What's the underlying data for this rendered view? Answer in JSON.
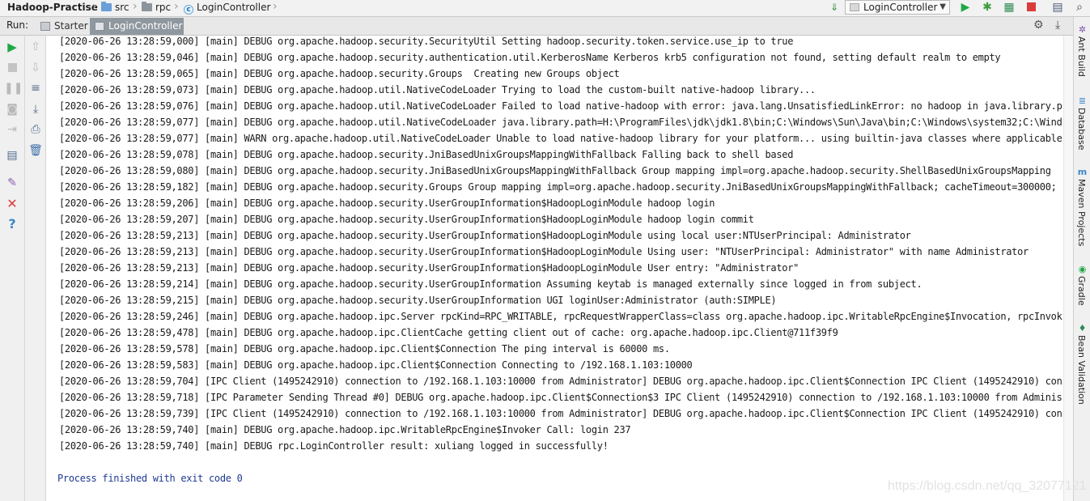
{
  "breadcrumb": {
    "project": "Hadoop-Practise",
    "folder1": "src",
    "folder2": "rpc",
    "file": "LoginController",
    "class_letter": "c"
  },
  "toolbar": {
    "run_config": "LoginController",
    "icons": [
      "build-icon",
      "run-icon",
      "debug-icon",
      "coverage-icon",
      "stop-icon",
      "project-structure-icon",
      "search-icon"
    ]
  },
  "run_panel": {
    "label": "Run:",
    "tabs": [
      {
        "label": "Starter",
        "active": false
      },
      {
        "label": "LoginController",
        "active": true
      }
    ]
  },
  "console": {
    "lines": [
      "[2020-06-26 13:28:59,000] [main] DEBUG org.apache.hadoop.security.SecurityUtil Setting hadoop.security.token.service.use_ip to true",
      "[2020-06-26 13:28:59,046] [main] DEBUG org.apache.hadoop.security.authentication.util.KerberosName Kerberos krb5 configuration not found, setting default realm to empty",
      "[2020-06-26 13:28:59,065] [main] DEBUG org.apache.hadoop.security.Groups  Creating new Groups object",
      "[2020-06-26 13:28:59,073] [main] DEBUG org.apache.hadoop.util.NativeCodeLoader Trying to load the custom-built native-hadoop library...",
      "[2020-06-26 13:28:59,076] [main] DEBUG org.apache.hadoop.util.NativeCodeLoader Failed to load native-hadoop with error: java.lang.UnsatisfiedLinkError: no hadoop in java.library.p",
      "[2020-06-26 13:28:59,077] [main] DEBUG org.apache.hadoop.util.NativeCodeLoader java.library.path=H:\\ProgramFiles\\jdk\\jdk1.8\\bin;C:\\Windows\\Sun\\Java\\bin;C:\\Windows\\system32;C:\\Wind",
      "[2020-06-26 13:28:59,077] [main] WARN org.apache.hadoop.util.NativeCodeLoader Unable to load native-hadoop library for your platform... using builtin-java classes where applicable",
      "[2020-06-26 13:28:59,078] [main] DEBUG org.apache.hadoop.security.JniBasedUnixGroupsMappingWithFallback Falling back to shell based",
      "[2020-06-26 13:28:59,080] [main] DEBUG org.apache.hadoop.security.JniBasedUnixGroupsMappingWithFallback Group mapping impl=org.apache.hadoop.security.ShellBasedUnixGroupsMapping",
      "[2020-06-26 13:28:59,182] [main] DEBUG org.apache.hadoop.security.Groups Group mapping impl=org.apache.hadoop.security.JniBasedUnixGroupsMappingWithFallback; cacheTimeout=300000;",
      "[2020-06-26 13:28:59,206] [main] DEBUG org.apache.hadoop.security.UserGroupInformation$HadoopLoginModule hadoop login",
      "[2020-06-26 13:28:59,207] [main] DEBUG org.apache.hadoop.security.UserGroupInformation$HadoopLoginModule hadoop login commit",
      "[2020-06-26 13:28:59,213] [main] DEBUG org.apache.hadoop.security.UserGroupInformation$HadoopLoginModule using local user:NTUserPrincipal: Administrator",
      "[2020-06-26 13:28:59,213] [main] DEBUG org.apache.hadoop.security.UserGroupInformation$HadoopLoginModule Using user: \"NTUserPrincipal: Administrator\" with name Administrator",
      "[2020-06-26 13:28:59,213] [main] DEBUG org.apache.hadoop.security.UserGroupInformation$HadoopLoginModule User entry: \"Administrator\"",
      "[2020-06-26 13:28:59,214] [main] DEBUG org.apache.hadoop.security.UserGroupInformation Assuming keytab is managed externally since logged in from subject.",
      "[2020-06-26 13:28:59,215] [main] DEBUG org.apache.hadoop.security.UserGroupInformation UGI loginUser:Administrator (auth:SIMPLE)",
      "[2020-06-26 13:28:59,246] [main] DEBUG org.apache.hadoop.ipc.Server rpcKind=RPC_WRITABLE, rpcRequestWrapperClass=class org.apache.hadoop.ipc.WritableRpcEngine$Invocation, rpcInvok",
      "[2020-06-26 13:28:59,478] [main] DEBUG org.apache.hadoop.ipc.ClientCache getting client out of cache: org.apache.hadoop.ipc.Client@711f39f9",
      "[2020-06-26 13:28:59,578] [main] DEBUG org.apache.hadoop.ipc.Client$Connection The ping interval is 60000 ms.",
      "[2020-06-26 13:28:59,583] [main] DEBUG org.apache.hadoop.ipc.Client$Connection Connecting to /192.168.1.103:10000",
      "[2020-06-26 13:28:59,704] [IPC Client (1495242910) connection to /192.168.1.103:10000 from Administrator] DEBUG org.apache.hadoop.ipc.Client$Connection IPC Client (1495242910) con",
      "[2020-06-26 13:28:59,718] [IPC Parameter Sending Thread #0] DEBUG org.apache.hadoop.ipc.Client$Connection$3 IPC Client (1495242910) connection to /192.168.1.103:10000 from Adminis",
      "[2020-06-26 13:28:59,739] [IPC Client (1495242910) connection to /192.168.1.103:10000 from Administrator] DEBUG org.apache.hadoop.ipc.Client$Connection IPC Client (1495242910) con",
      "[2020-06-26 13:28:59,740] [main] DEBUG org.apache.hadoop.ipc.WritableRpcEngine$Invoker Call: login 237",
      "[2020-06-26 13:28:59,740] [main] DEBUG rpc.LoginController result: xuliang logged in successfully!"
    ],
    "process_line": "Process finished with exit code 0"
  },
  "right_tools": [
    "Ant Build",
    "Database",
    "Maven Projects",
    "Gradle",
    "Bean Validation"
  ],
  "watermark": "https://blog.csdn.net/qq_32077121",
  "colors": {
    "run_green": "#1fa845",
    "stop_red": "#db3b3b",
    "active_tab": "#8f979f",
    "process_text": "#1f3a93"
  }
}
